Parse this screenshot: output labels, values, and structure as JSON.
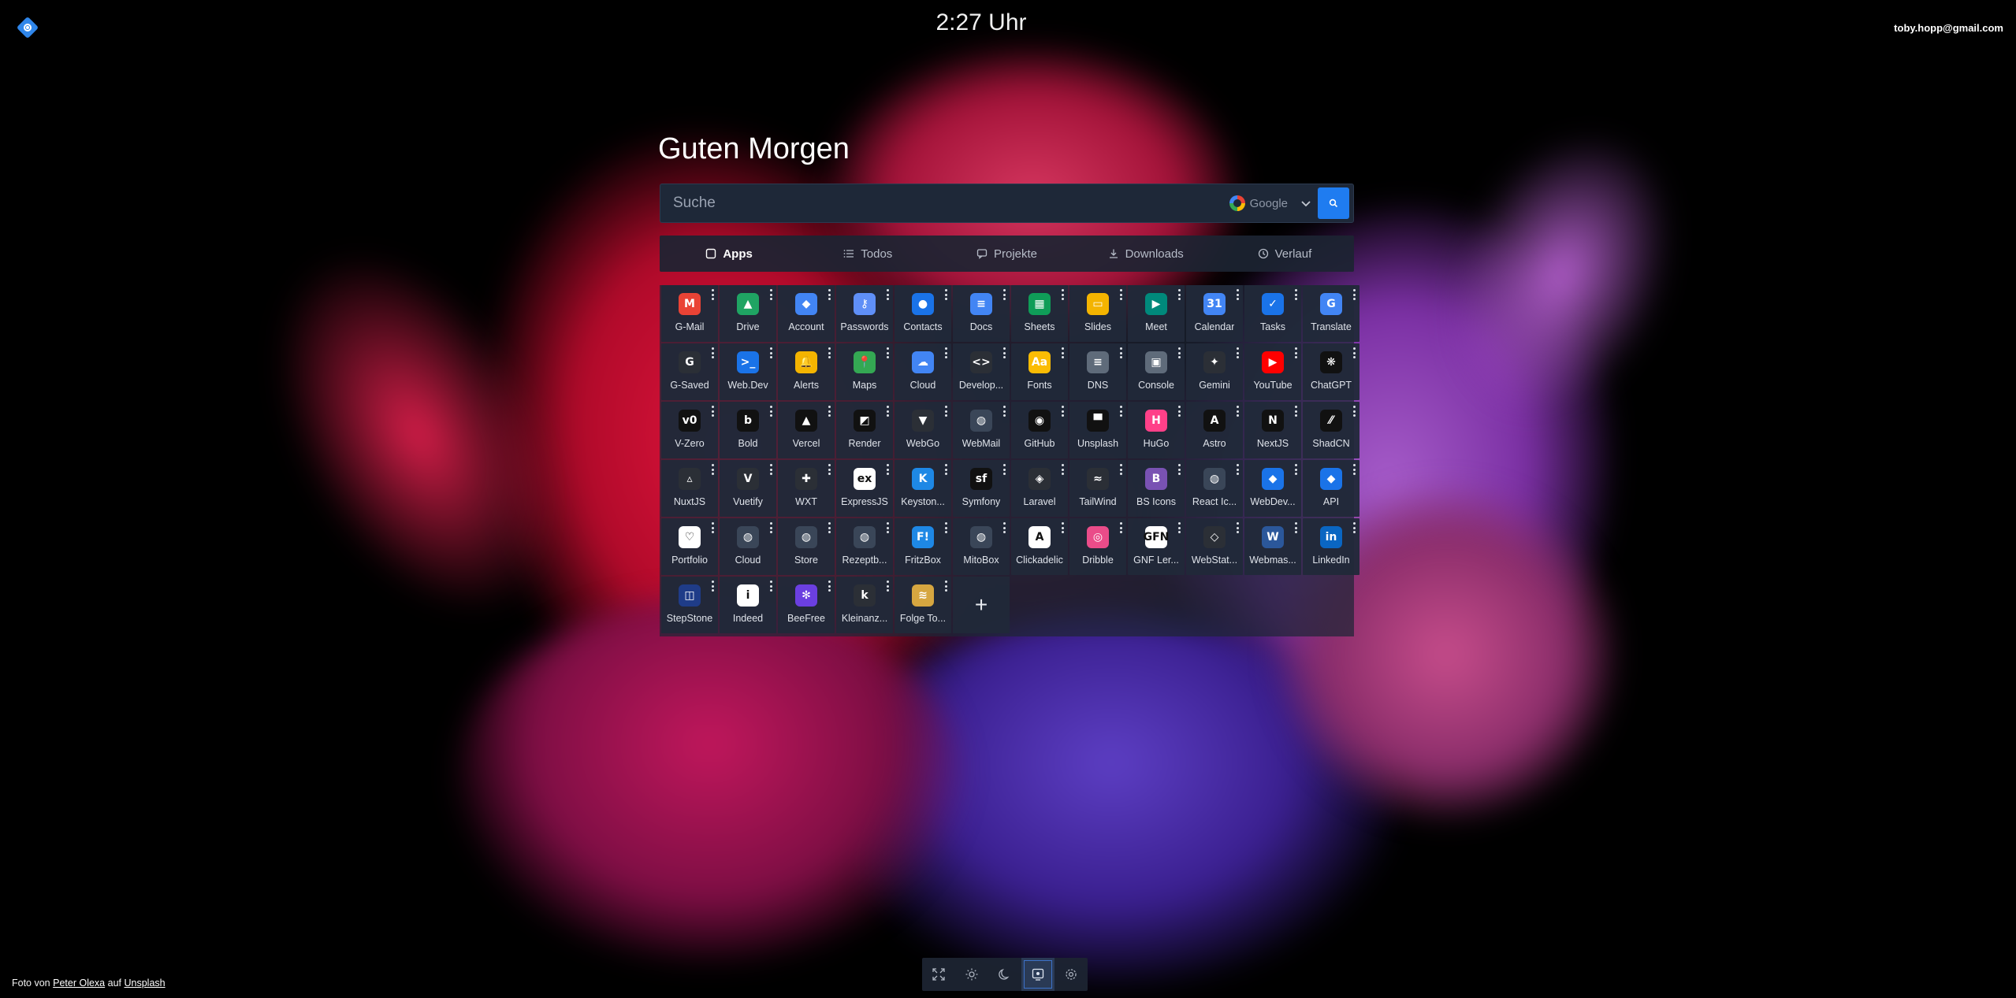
{
  "header": {
    "clock": "2:27 Uhr",
    "user_email": "toby.hopp@gmail.com"
  },
  "greeting": "Guten Morgen",
  "search": {
    "placeholder": "Suche",
    "engine": "Google"
  },
  "tabs": [
    {
      "label": "Apps",
      "icon": "square-icon",
      "active": true
    },
    {
      "label": "Todos",
      "icon": "list-icon",
      "active": false
    },
    {
      "label": "Projekte",
      "icon": "chat-icon",
      "active": false
    },
    {
      "label": "Downloads",
      "icon": "download-icon",
      "active": false
    },
    {
      "label": "Verlauf",
      "icon": "history-icon",
      "active": false
    }
  ],
  "apps": [
    {
      "label": "G-Mail",
      "icon": "gmail-icon",
      "color": "#ea4335",
      "glyph": "M"
    },
    {
      "label": "Drive",
      "icon": "drive-icon",
      "color": "#1fa463",
      "glyph": "▲"
    },
    {
      "label": "Account",
      "icon": "shield-icon",
      "color": "#4285f4",
      "glyph": "◆"
    },
    {
      "label": "Passwords",
      "icon": "key-icon",
      "color": "#5f8ff7",
      "glyph": "⚷"
    },
    {
      "label": "Contacts",
      "icon": "contacts-icon",
      "color": "#1a73e8",
      "glyph": "●"
    },
    {
      "label": "Docs",
      "icon": "docs-icon",
      "color": "#4285f4",
      "glyph": "≡"
    },
    {
      "label": "Sheets",
      "icon": "sheets-icon",
      "color": "#0f9d58",
      "glyph": "▦"
    },
    {
      "label": "Slides",
      "icon": "slides-icon",
      "color": "#f4b400",
      "glyph": "▭"
    },
    {
      "label": "Meet",
      "icon": "meet-icon",
      "color": "#00897b",
      "glyph": "▶"
    },
    {
      "label": "Calendar",
      "icon": "calendar-icon",
      "color": "#4285f4",
      "glyph": "31"
    },
    {
      "label": "Tasks",
      "icon": "tasks-icon",
      "color": "#1a73e8",
      "glyph": "✓"
    },
    {
      "label": "Translate",
      "icon": "translate-icon",
      "color": "#4285f4",
      "glyph": "G"
    },
    {
      "label": "G-Saved",
      "icon": "google-icon",
      "color": "#2b2f36",
      "glyph": "G"
    },
    {
      "label": "Web.Dev",
      "icon": "webdev-icon",
      "color": "#1a73e8",
      "glyph": ">_"
    },
    {
      "label": "Alerts",
      "icon": "bell-icon",
      "color": "#f4b400",
      "glyph": "🔔"
    },
    {
      "label": "Maps",
      "icon": "maps-icon",
      "color": "#34a853",
      "glyph": "📍"
    },
    {
      "label": "Cloud",
      "icon": "cloud-icon",
      "color": "#4285f4",
      "glyph": "☁"
    },
    {
      "label": "Develop...",
      "icon": "code-icon",
      "color": "#2b2f36",
      "glyph": "<>"
    },
    {
      "label": "Fonts",
      "icon": "fonts-icon",
      "color": "#fbbc04",
      "glyph": "Aa"
    },
    {
      "label": "DNS",
      "icon": "dns-icon",
      "color": "#5f6b7a",
      "glyph": "≡"
    },
    {
      "label": "Console",
      "icon": "console-icon",
      "color": "#5f6b7a",
      "glyph": "▣"
    },
    {
      "label": "Gemini",
      "icon": "gemini-icon",
      "color": "#2b2f36",
      "glyph": "✦"
    },
    {
      "label": "YouTube",
      "icon": "youtube-icon",
      "color": "#ff0000",
      "glyph": "▶"
    },
    {
      "label": "ChatGPT",
      "icon": "chatgpt-icon",
      "color": "#111111",
      "glyph": "❋"
    },
    {
      "label": "V-Zero",
      "icon": "vzero-icon",
      "color": "#111111",
      "glyph": "v0"
    },
    {
      "label": "Bold",
      "icon": "bold-icon",
      "color": "#111111",
      "glyph": "b"
    },
    {
      "label": "Vercel",
      "icon": "vercel-icon",
      "color": "#111111",
      "glyph": "▲"
    },
    {
      "label": "Render",
      "icon": "render-icon",
      "color": "#111111",
      "glyph": "◩"
    },
    {
      "label": "WebGo",
      "icon": "webgo-icon",
      "color": "#2b2f36",
      "glyph": "▼"
    },
    {
      "label": "WebMail",
      "icon": "globe-icon",
      "color": "#3a4658",
      "glyph": "◍"
    },
    {
      "label": "GitHub",
      "icon": "github-icon",
      "color": "#111111",
      "glyph": "◉"
    },
    {
      "label": "Unsplash",
      "icon": "unsplash-icon",
      "color": "#111111",
      "glyph": "▀"
    },
    {
      "label": "HuGo",
      "icon": "hugo-icon",
      "color": "#ff4088",
      "glyph": "H"
    },
    {
      "label": "Astro",
      "icon": "astro-icon",
      "color": "#111111",
      "glyph": "A"
    },
    {
      "label": "NextJS",
      "icon": "nextjs-icon",
      "color": "#111111",
      "glyph": "N"
    },
    {
      "label": "ShadCN",
      "icon": "shadcn-icon",
      "color": "#111111",
      "glyph": "⁄⁄"
    },
    {
      "label": "NuxtJS",
      "icon": "nuxt-icon",
      "color": "#2b2f36",
      "glyph": "▵"
    },
    {
      "label": "Vuetify",
      "icon": "vuetify-icon",
      "color": "#2b2f36",
      "glyph": "V"
    },
    {
      "label": "WXT",
      "icon": "wxt-icon",
      "color": "#2b2f36",
      "glyph": "✚"
    },
    {
      "label": "ExpressJS",
      "icon": "express-icon",
      "color": "#ffffff",
      "glyph": "ex"
    },
    {
      "label": "Keyston...",
      "icon": "keystone-icon",
      "color": "#1e88e5",
      "glyph": "K"
    },
    {
      "label": "Symfony",
      "icon": "symfony-icon",
      "color": "#111111",
      "glyph": "sf"
    },
    {
      "label": "Laravel",
      "icon": "laravel-icon",
      "color": "#2b2f36",
      "glyph": "◈"
    },
    {
      "label": "TailWind",
      "icon": "tailwind-icon",
      "color": "#2b2f36",
      "glyph": "≈"
    },
    {
      "label": "BS Icons",
      "icon": "bootstrap-icon",
      "color": "#7952b3",
      "glyph": "B"
    },
    {
      "label": "React Ic...",
      "icon": "globe-icon",
      "color": "#3a4658",
      "glyph": "◍"
    },
    {
      "label": "WebDev...",
      "icon": "webdev-diamond-icon",
      "color": "#1a73e8",
      "glyph": "◆"
    },
    {
      "label": "API",
      "icon": "api-icon",
      "color": "#1a73e8",
      "glyph": "◆"
    },
    {
      "label": "Portfolio",
      "icon": "portfolio-icon",
      "color": "#ffffff",
      "glyph": "♡"
    },
    {
      "label": "Cloud",
      "icon": "globe-icon",
      "color": "#3a4658",
      "glyph": "◍"
    },
    {
      "label": "Store",
      "icon": "globe-icon",
      "color": "#3a4658",
      "glyph": "◍"
    },
    {
      "label": "Rezeptb...",
      "icon": "globe-icon",
      "color": "#3a4658",
      "glyph": "◍"
    },
    {
      "label": "FritzBox",
      "icon": "fritzbox-icon",
      "color": "#1e88e5",
      "glyph": "F!"
    },
    {
      "label": "MitoBox",
      "icon": "globe-icon",
      "color": "#3a4658",
      "glyph": "◍"
    },
    {
      "label": "Clickadelic",
      "icon": "clickadelic-icon",
      "color": "#ffffff",
      "glyph": "A"
    },
    {
      "label": "Dribble",
      "icon": "dribbble-icon",
      "color": "#ea4c89",
      "glyph": "◎"
    },
    {
      "label": "GNF Ler...",
      "icon": "gnf-icon",
      "color": "#ffffff",
      "glyph": "GFN"
    },
    {
      "label": "WebStat...",
      "icon": "webstat-icon",
      "color": "#2b2f36",
      "glyph": "◇"
    },
    {
      "label": "Webmas...",
      "icon": "word-icon",
      "color": "#2b579a",
      "glyph": "W"
    },
    {
      "label": "LinkedIn",
      "icon": "linkedin-icon",
      "color": "#0a66c2",
      "glyph": "in"
    },
    {
      "label": "StepStone",
      "icon": "stepstone-icon",
      "color": "#1f3c88",
      "glyph": "◫"
    },
    {
      "label": "Indeed",
      "icon": "indeed-icon",
      "color": "#ffffff",
      "glyph": "i"
    },
    {
      "label": "BeeFree",
      "icon": "beefree-icon",
      "color": "#6b3fe0",
      "glyph": "✻"
    },
    {
      "label": "Kleinanz...",
      "icon": "kleinanzeigen-icon",
      "color": "#2b2f36",
      "glyph": "k"
    },
    {
      "label": "Folge To...",
      "icon": "folge-icon",
      "color": "#d6a640",
      "glyph": "≋"
    }
  ],
  "add_tile": "+",
  "footer": {
    "prefix": "Foto von",
    "author": "Peter Olexa",
    "mid": "auf",
    "source": "Unsplash"
  },
  "bottom_bar": [
    {
      "name": "fullscreen-icon",
      "active": false
    },
    {
      "name": "sun-icon",
      "active": false
    },
    {
      "name": "moon-icon",
      "active": false
    },
    {
      "name": "display-icon",
      "active": true
    },
    {
      "name": "settings-icon",
      "active": false
    }
  ]
}
